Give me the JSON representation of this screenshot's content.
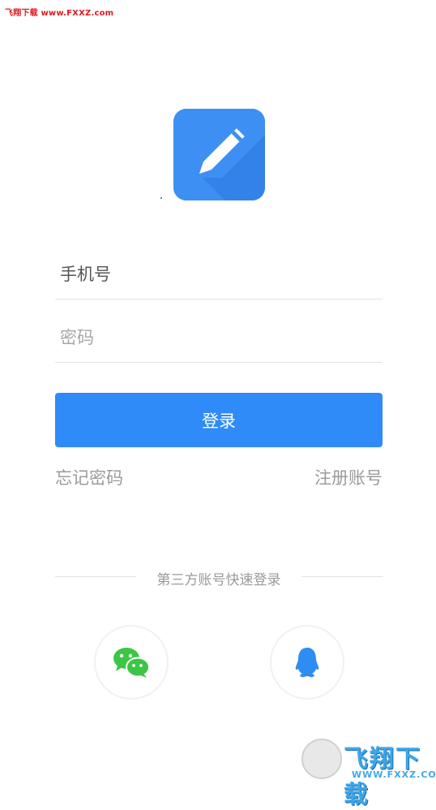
{
  "watermark": {
    "top_text": "飞翔下载 www.FXXZ.com",
    "logo_name": "飞翔下载",
    "logo_url": "WWW.FXXZ.COM"
  },
  "app_icon": "pencil-icon",
  "login_form": {
    "phone_placeholder": "手机号",
    "password_placeholder": "密码",
    "login_label": "登录"
  },
  "links": {
    "forgot_password": "忘记密码",
    "register": "注册账号"
  },
  "third_party": {
    "title": "第三方账号快速登录",
    "providers": [
      {
        "name": "wechat-icon",
        "color": "#3bc645"
      },
      {
        "name": "qq-icon",
        "color": "#2d8df2"
      }
    ]
  },
  "colors": {
    "primary": "#2f8bf7",
    "icon_bg": "#3d8ff4",
    "wechat": "#3bc645",
    "qq": "#2d8df2"
  }
}
